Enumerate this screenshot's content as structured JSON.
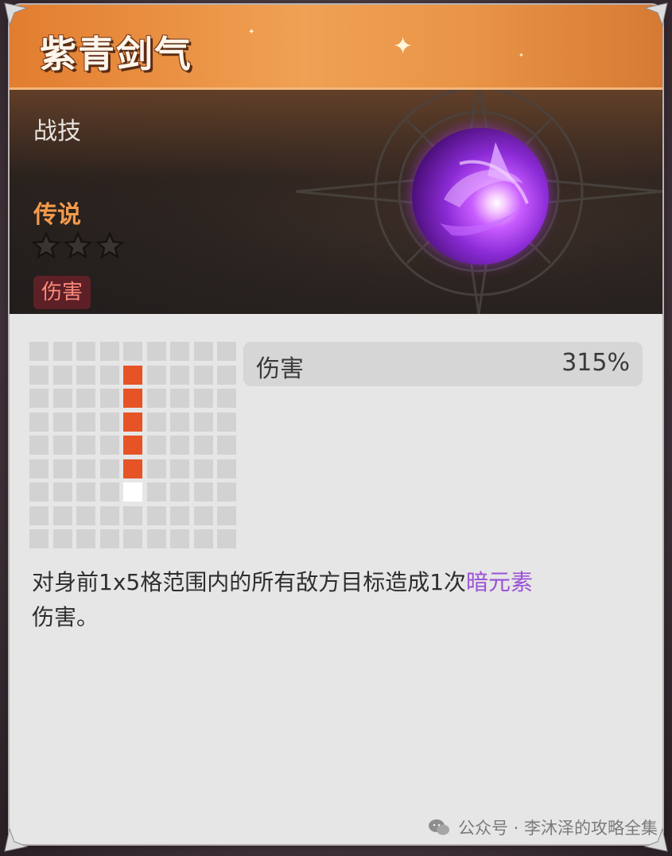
{
  "card": {
    "title": "紫青剑气",
    "skill_type": "战技",
    "rarity": "传说",
    "stars": {
      "filled": 0,
      "total": 3
    },
    "tag": "伤害"
  },
  "range_grid": {
    "rows": 9,
    "cols": 9,
    "hit_cells": [
      [
        1,
        4
      ],
      [
        2,
        4
      ],
      [
        3,
        4
      ],
      [
        4,
        4
      ],
      [
        5,
        4
      ]
    ],
    "self_cell": [
      6,
      4
    ]
  },
  "stats": [
    {
      "label": "伤害",
      "value": "315%"
    }
  ],
  "description": {
    "before": "对身前1x5格范围内的所有敌方目标造成1次",
    "element": "暗元素",
    "after": "伤害。"
  },
  "watermark": {
    "text": "公众号 · 李沐泽的攻略全集",
    "icon": "wechat-icon"
  },
  "colors": {
    "title_bar": "#e98a3d",
    "rarity": "#f39a4b",
    "hit_cell": "#e55326",
    "element": "#9a52d6",
    "tag_bg": "#5c2026",
    "tag_text": "#ff8a7c"
  }
}
